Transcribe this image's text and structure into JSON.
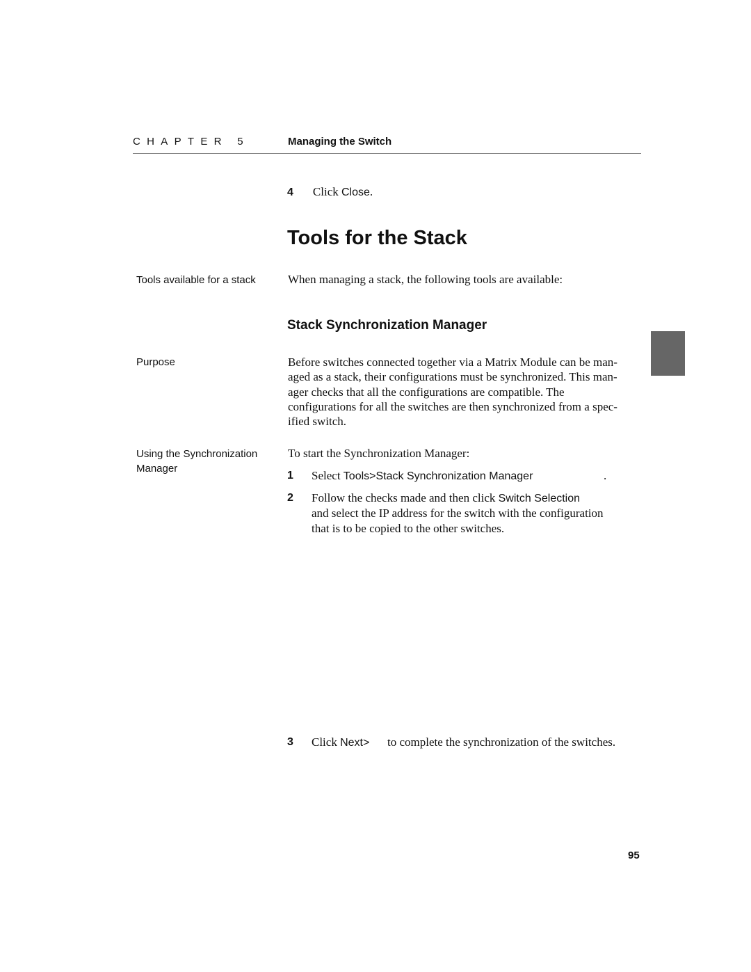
{
  "header": {
    "chapter_label": "CHAPTER 5",
    "chapter_title": "Managing the Switch"
  },
  "top_step": {
    "number": "4",
    "prefix": "Click ",
    "ui_label": "Close",
    "suffix": "."
  },
  "section": {
    "title": "Tools for the Stack",
    "margin_note": "Tools available for a stack",
    "intro": "When managing a stack, the following tools are available:"
  },
  "subsection": {
    "title": "Stack Synchronization Manager",
    "purpose_label": "Purpose",
    "purpose_lines": [
      "Before switches connected together via a Matrix Module can be man-",
      "aged as a stack, their configurations must be synchronized. This man-",
      "ager checks that all the configurations are compatible. The",
      "configurations for all the switches are then synchronized from a spec-",
      "ified switch."
    ],
    "using_label_line1": "Using the Synchronization",
    "using_label_line2": "Manager",
    "using_intro": "To start the Synchronization Manager:",
    "steps": [
      {
        "number": "1",
        "prefix": "Select ",
        "ui_label": "Tools>Stack Synchronization Manager",
        "suffix": "."
      },
      {
        "number": "2",
        "prefix": "Follow the checks made and then click ",
        "ui_label": "Switch Selection",
        "continuation": [
          "and select the IP address for the switch with the configuration",
          "that is to be copied to the other switches."
        ]
      },
      {
        "number": "3",
        "prefix": "Click ",
        "ui_label": "Next>",
        "suffix": "to complete the synchronization of the switches."
      }
    ]
  },
  "footer": {
    "page_number": "95"
  },
  "colors": {
    "text": "#111111",
    "rule": "#777777",
    "thumb_tab": "#666666"
  }
}
